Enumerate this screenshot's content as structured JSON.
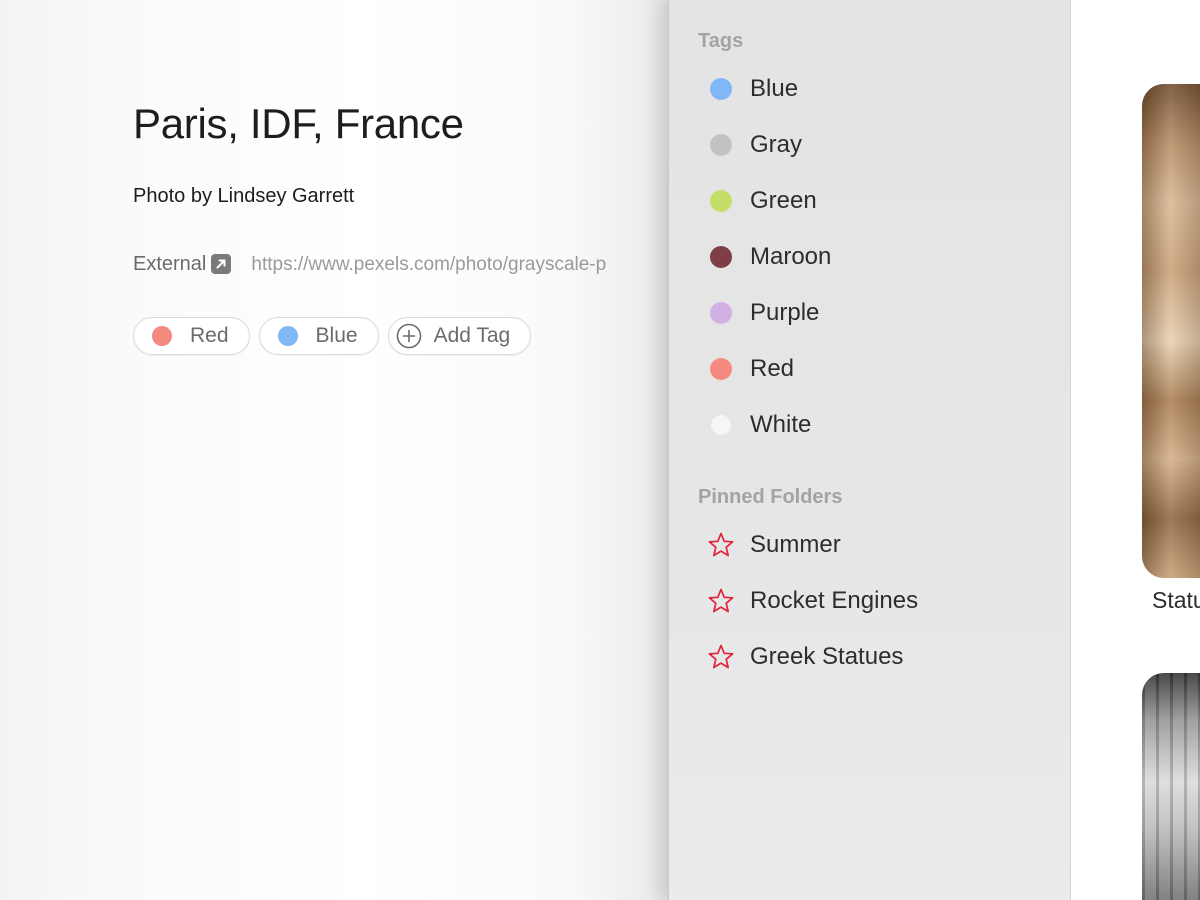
{
  "detail": {
    "title": "Paris, IDF, France",
    "credit": "Photo by Lindsey Garrett",
    "external_label": "External",
    "external_url": "https://www.pexels.com/photo/grayscale-p",
    "tags": [
      {
        "label": "Red",
        "color": "#f58a80"
      },
      {
        "label": "Blue",
        "color": "#7fb7f7"
      }
    ],
    "add_tag_label": "Add Tag"
  },
  "sidebar": {
    "tags_header": "Tags",
    "tags": [
      {
        "label": "Blue",
        "color": "#7fb7f7"
      },
      {
        "label": "Gray",
        "color": "#c2c2c2"
      },
      {
        "label": "Green",
        "color": "#c5de6a"
      },
      {
        "label": "Maroon",
        "color": "#7d3f45"
      },
      {
        "label": "Purple",
        "color": "#d3b0e4"
      },
      {
        "label": "Red",
        "color": "#f58a80"
      },
      {
        "label": "White",
        "color": "#f6f6f6"
      }
    ],
    "pinned_header": "Pinned Folders",
    "pinned": [
      {
        "label": "Summer",
        "icon": "star-icon"
      },
      {
        "label": "Rocket Engines",
        "icon": "star-icon"
      },
      {
        "label": "Greek Statues",
        "icon": "star-icon"
      }
    ],
    "star_color": "#e0243b"
  },
  "gallery": {
    "caption": "Statu"
  }
}
